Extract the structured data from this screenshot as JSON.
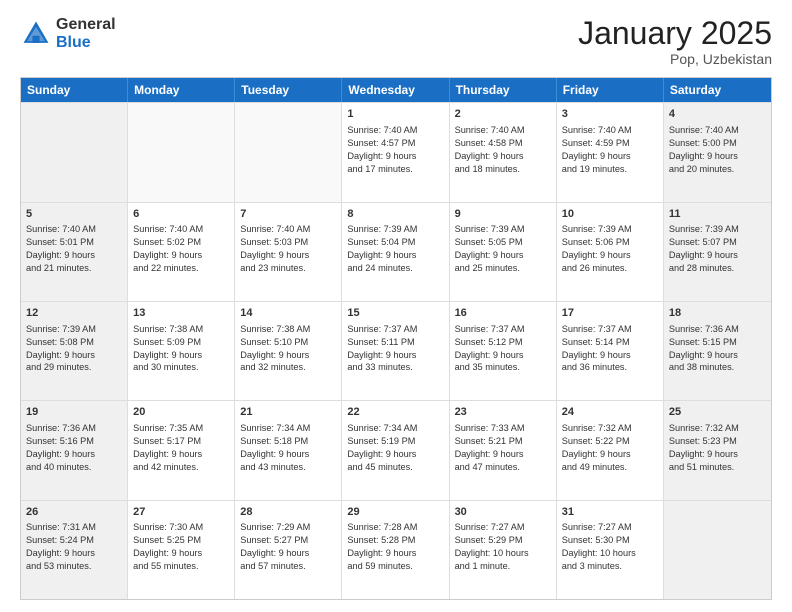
{
  "logo": {
    "general": "General",
    "blue": "Blue"
  },
  "header": {
    "month": "January 2025",
    "location": "Pop, Uzbekistan"
  },
  "weekdays": [
    "Sunday",
    "Monday",
    "Tuesday",
    "Wednesday",
    "Thursday",
    "Friday",
    "Saturday"
  ],
  "weeks": [
    [
      {
        "day": "",
        "info": ""
      },
      {
        "day": "",
        "info": ""
      },
      {
        "day": "",
        "info": ""
      },
      {
        "day": "1",
        "info": "Sunrise: 7:40 AM\nSunset: 4:57 PM\nDaylight: 9 hours\nand 17 minutes."
      },
      {
        "day": "2",
        "info": "Sunrise: 7:40 AM\nSunset: 4:58 PM\nDaylight: 9 hours\nand 18 minutes."
      },
      {
        "day": "3",
        "info": "Sunrise: 7:40 AM\nSunset: 4:59 PM\nDaylight: 9 hours\nand 19 minutes."
      },
      {
        "day": "4",
        "info": "Sunrise: 7:40 AM\nSunset: 5:00 PM\nDaylight: 9 hours\nand 20 minutes."
      }
    ],
    [
      {
        "day": "5",
        "info": "Sunrise: 7:40 AM\nSunset: 5:01 PM\nDaylight: 9 hours\nand 21 minutes."
      },
      {
        "day": "6",
        "info": "Sunrise: 7:40 AM\nSunset: 5:02 PM\nDaylight: 9 hours\nand 22 minutes."
      },
      {
        "day": "7",
        "info": "Sunrise: 7:40 AM\nSunset: 5:03 PM\nDaylight: 9 hours\nand 23 minutes."
      },
      {
        "day": "8",
        "info": "Sunrise: 7:39 AM\nSunset: 5:04 PM\nDaylight: 9 hours\nand 24 minutes."
      },
      {
        "day": "9",
        "info": "Sunrise: 7:39 AM\nSunset: 5:05 PM\nDaylight: 9 hours\nand 25 minutes."
      },
      {
        "day": "10",
        "info": "Sunrise: 7:39 AM\nSunset: 5:06 PM\nDaylight: 9 hours\nand 26 minutes."
      },
      {
        "day": "11",
        "info": "Sunrise: 7:39 AM\nSunset: 5:07 PM\nDaylight: 9 hours\nand 28 minutes."
      }
    ],
    [
      {
        "day": "12",
        "info": "Sunrise: 7:39 AM\nSunset: 5:08 PM\nDaylight: 9 hours\nand 29 minutes."
      },
      {
        "day": "13",
        "info": "Sunrise: 7:38 AM\nSunset: 5:09 PM\nDaylight: 9 hours\nand 30 minutes."
      },
      {
        "day": "14",
        "info": "Sunrise: 7:38 AM\nSunset: 5:10 PM\nDaylight: 9 hours\nand 32 minutes."
      },
      {
        "day": "15",
        "info": "Sunrise: 7:37 AM\nSunset: 5:11 PM\nDaylight: 9 hours\nand 33 minutes."
      },
      {
        "day": "16",
        "info": "Sunrise: 7:37 AM\nSunset: 5:12 PM\nDaylight: 9 hours\nand 35 minutes."
      },
      {
        "day": "17",
        "info": "Sunrise: 7:37 AM\nSunset: 5:14 PM\nDaylight: 9 hours\nand 36 minutes."
      },
      {
        "day": "18",
        "info": "Sunrise: 7:36 AM\nSunset: 5:15 PM\nDaylight: 9 hours\nand 38 minutes."
      }
    ],
    [
      {
        "day": "19",
        "info": "Sunrise: 7:36 AM\nSunset: 5:16 PM\nDaylight: 9 hours\nand 40 minutes."
      },
      {
        "day": "20",
        "info": "Sunrise: 7:35 AM\nSunset: 5:17 PM\nDaylight: 9 hours\nand 42 minutes."
      },
      {
        "day": "21",
        "info": "Sunrise: 7:34 AM\nSunset: 5:18 PM\nDaylight: 9 hours\nand 43 minutes."
      },
      {
        "day": "22",
        "info": "Sunrise: 7:34 AM\nSunset: 5:19 PM\nDaylight: 9 hours\nand 45 minutes."
      },
      {
        "day": "23",
        "info": "Sunrise: 7:33 AM\nSunset: 5:21 PM\nDaylight: 9 hours\nand 47 minutes."
      },
      {
        "day": "24",
        "info": "Sunrise: 7:32 AM\nSunset: 5:22 PM\nDaylight: 9 hours\nand 49 minutes."
      },
      {
        "day": "25",
        "info": "Sunrise: 7:32 AM\nSunset: 5:23 PM\nDaylight: 9 hours\nand 51 minutes."
      }
    ],
    [
      {
        "day": "26",
        "info": "Sunrise: 7:31 AM\nSunset: 5:24 PM\nDaylight: 9 hours\nand 53 minutes."
      },
      {
        "day": "27",
        "info": "Sunrise: 7:30 AM\nSunset: 5:25 PM\nDaylight: 9 hours\nand 55 minutes."
      },
      {
        "day": "28",
        "info": "Sunrise: 7:29 AM\nSunset: 5:27 PM\nDaylight: 9 hours\nand 57 minutes."
      },
      {
        "day": "29",
        "info": "Sunrise: 7:28 AM\nSunset: 5:28 PM\nDaylight: 9 hours\nand 59 minutes."
      },
      {
        "day": "30",
        "info": "Sunrise: 7:27 AM\nSunset: 5:29 PM\nDaylight: 10 hours\nand 1 minute."
      },
      {
        "day": "31",
        "info": "Sunrise: 7:27 AM\nSunset: 5:30 PM\nDaylight: 10 hours\nand 3 minutes."
      },
      {
        "day": "",
        "info": ""
      }
    ]
  ]
}
